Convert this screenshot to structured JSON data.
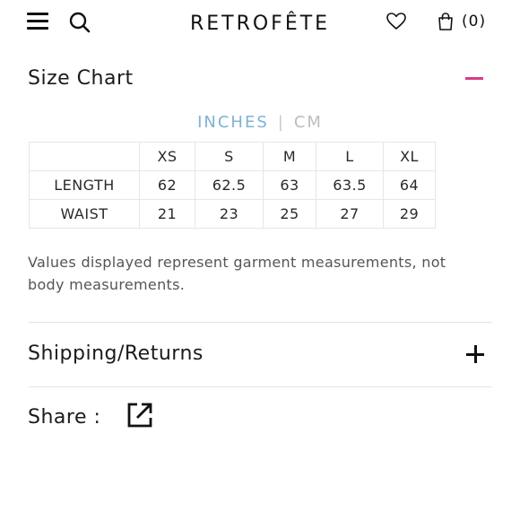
{
  "header": {
    "brand": "RETROFÊTE",
    "cart_count": "(0)",
    "icons": [
      "menu-icon",
      "search-icon",
      "heart-icon",
      "bag-icon"
    ]
  },
  "size_chart": {
    "title": "Size Chart",
    "units": {
      "active": "INCHES",
      "separator": "|",
      "inactive": "CM"
    },
    "columns": [
      "XS",
      "S",
      "M",
      "L",
      "XL"
    ],
    "rows": [
      {
        "label": "LENGTH",
        "values": [
          "62",
          "62.5",
          "63",
          "63.5",
          "64"
        ]
      },
      {
        "label": "WAIST",
        "values": [
          "21",
          "23",
          "25",
          "27",
          "29"
        ]
      }
    ],
    "note": "Values displayed represent garment measurements, not body measurements."
  },
  "shipping": {
    "title": "Shipping/Returns"
  },
  "share": {
    "label": "Share :"
  },
  "colors": {
    "accent_pink": "#d63c8c",
    "active_unit_blue": "#7fb1d6"
  }
}
